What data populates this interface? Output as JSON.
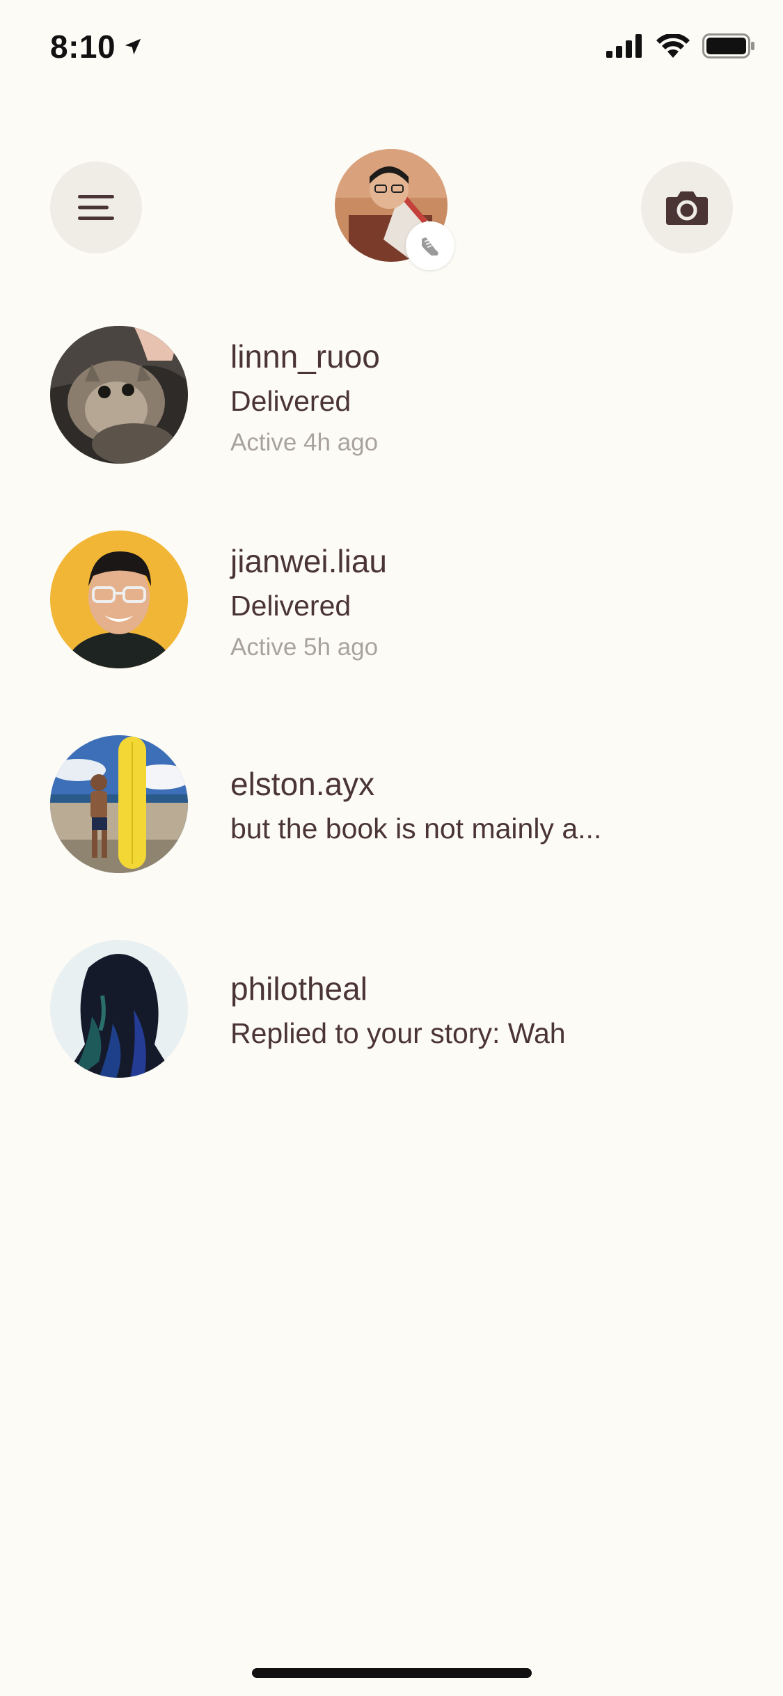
{
  "status_bar": {
    "time": "8:10"
  },
  "header": {
    "menu_icon": "hamburger-menu-icon",
    "camera_icon": "camera-icon",
    "profile_badge_icon": "sneaker-icon"
  },
  "conversations": [
    {
      "username": "linnn_ruoo",
      "status": "Delivered",
      "active": "Active 4h ago"
    },
    {
      "username": "jianwei.liau",
      "status": "Delivered",
      "active": "Active 5h ago"
    },
    {
      "username": "elston.ayx",
      "status": "but the book is not mainly a..."
    },
    {
      "username": "philotheal",
      "status": "Replied to your story: Wah"
    }
  ],
  "colors": {
    "background": "#fdfbf6",
    "text_primary": "#4a3434",
    "text_secondary": "#a8a3a0",
    "button_bg": "#f0ece6"
  }
}
